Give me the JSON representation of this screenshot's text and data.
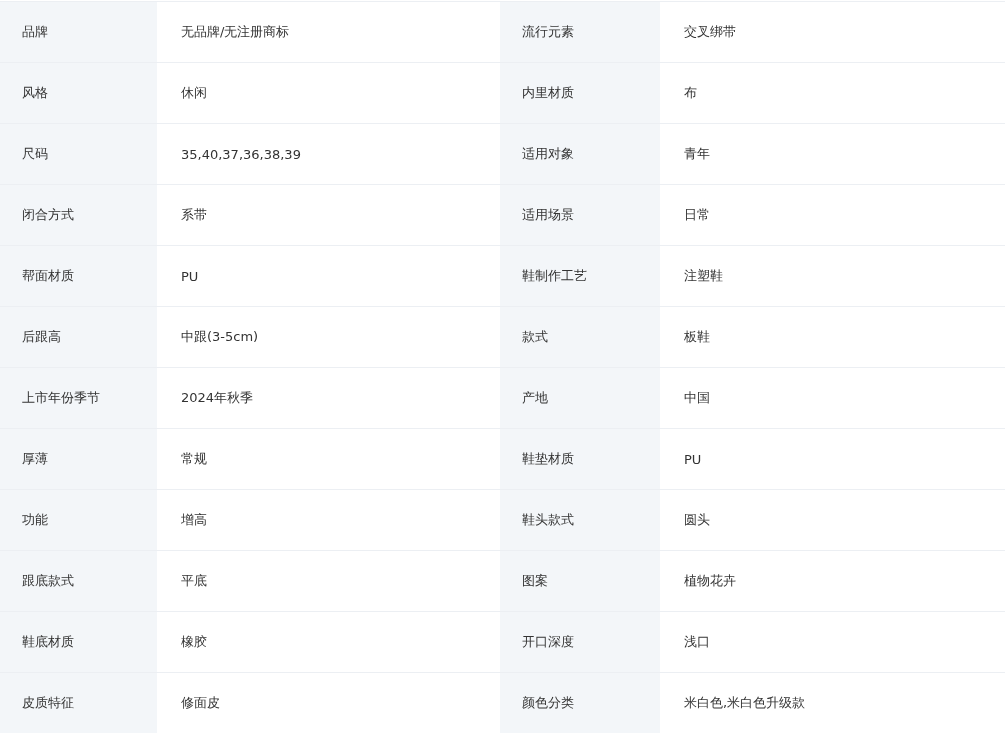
{
  "attributes": [
    {
      "name": "品牌",
      "value": "无品牌/无注册商标"
    },
    {
      "name": "流行元素",
      "value": "交叉绑带"
    },
    {
      "name": "风格",
      "value": "休闲"
    },
    {
      "name": "内里材质",
      "value": "布"
    },
    {
      "name": "尺码",
      "value": "35,40,37,36,38,39"
    },
    {
      "name": "适用对象",
      "value": "青年"
    },
    {
      "name": "闭合方式",
      "value": "系带"
    },
    {
      "name": "适用场景",
      "value": "日常"
    },
    {
      "name": "帮面材质",
      "value": "PU"
    },
    {
      "name": "鞋制作工艺",
      "value": "注塑鞋"
    },
    {
      "name": "后跟高",
      "value": "中跟(3-5cm)"
    },
    {
      "name": "款式",
      "value": "板鞋"
    },
    {
      "name": "上市年份季节",
      "value": "2024年秋季"
    },
    {
      "name": "产地",
      "value": "中国"
    },
    {
      "name": "厚薄",
      "value": "常规"
    },
    {
      "name": "鞋垫材质",
      "value": "PU"
    },
    {
      "name": "功能",
      "value": "增高"
    },
    {
      "name": "鞋头款式",
      "value": "圆头"
    },
    {
      "name": "跟底款式",
      "value": "平底"
    },
    {
      "name": "图案",
      "value": "植物花卉"
    },
    {
      "name": "鞋底材质",
      "value": "橡胶"
    },
    {
      "name": "开口深度",
      "value": "浅口"
    },
    {
      "name": "皮质特征",
      "value": "修面皮"
    },
    {
      "name": "颜色分类",
      "value": "米白色,米白色升级款"
    }
  ]
}
